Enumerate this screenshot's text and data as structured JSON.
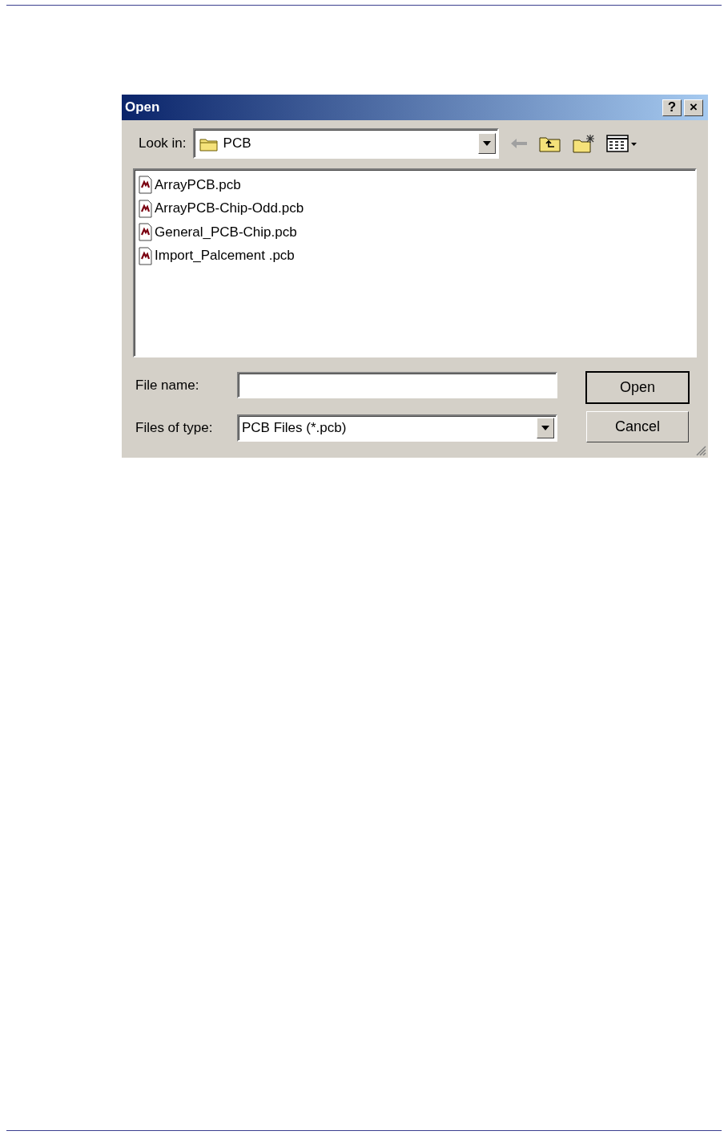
{
  "window": {
    "title": "Open",
    "title_buttons": [
      "?",
      "×"
    ]
  },
  "look_in": {
    "label": "Look in:",
    "value": "PCB"
  },
  "files": [
    {
      "name": "ArrayPCB.pcb"
    },
    {
      "name": "ArrayPCB-Chip-Odd.pcb"
    },
    {
      "name": "General_PCB-Chip.pcb"
    },
    {
      "name": "Import_Palcement .pcb"
    }
  ],
  "file_name": {
    "label": "File name:"
  },
  "files_of_type": {
    "label": "Files of type:",
    "value": "PCB Files (*.pcb)"
  },
  "buttons": [
    {
      "label": "Open",
      "default": true
    },
    {
      "label": "Cancel",
      "default": false
    }
  ]
}
